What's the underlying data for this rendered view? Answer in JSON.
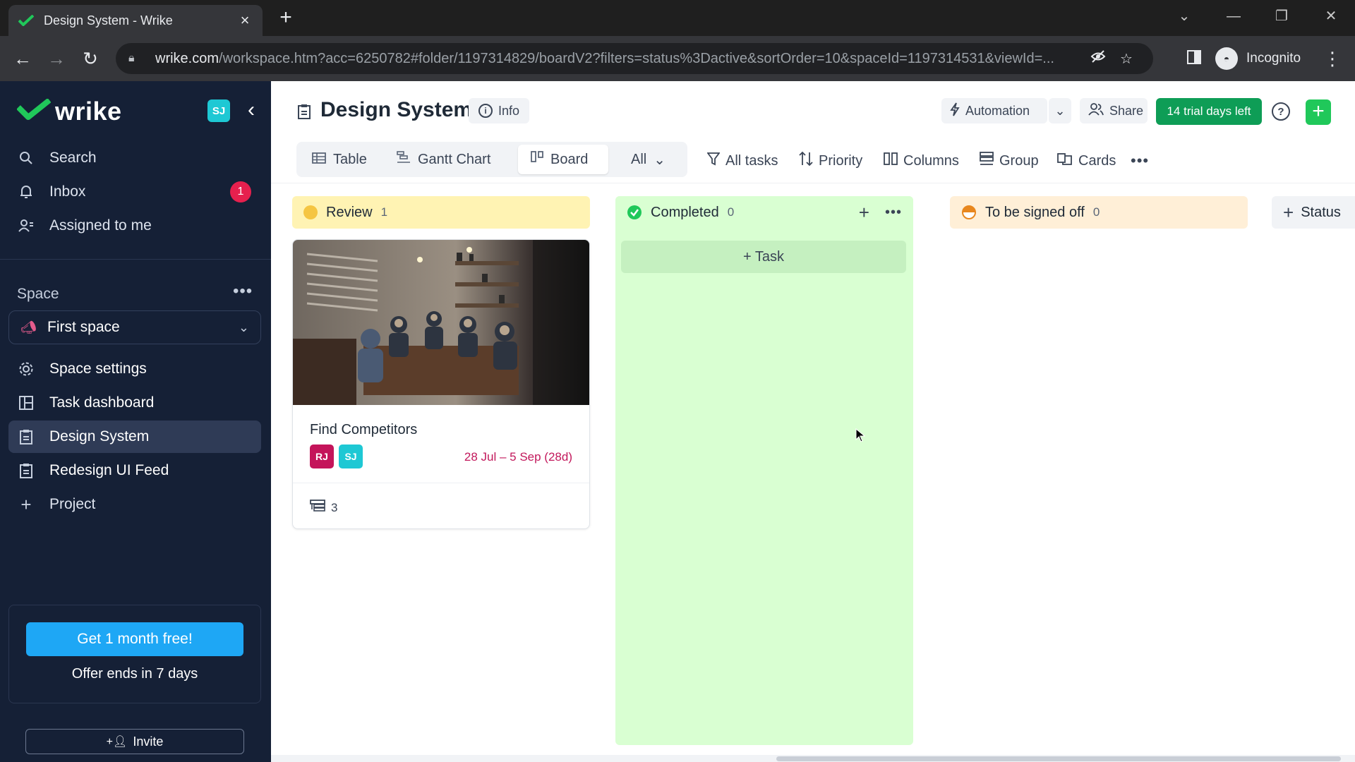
{
  "browser": {
    "tab_title": "Design System - Wrike",
    "url_host": "wrike.com",
    "url_path": "/workspace.htm?acc=6250782#folder/1197314829/boardV2?filters=status%3Dactive&sortOrder=10&spaceId=1197314531&viewId=...",
    "incognito_label": "Incognito"
  },
  "sidebar": {
    "brand": "wrike",
    "user_initials": "SJ",
    "nav": [
      {
        "label": "Search",
        "icon": "search-icon"
      },
      {
        "label": "Inbox",
        "icon": "bell-icon",
        "badge": "1"
      },
      {
        "label": "Assigned to me",
        "icon": "user-icon"
      }
    ],
    "space_label": "Space",
    "space_name": "First space",
    "items": [
      {
        "label": "Space settings",
        "icon": "gear-icon"
      },
      {
        "label": "Task dashboard",
        "icon": "dashboard-icon"
      },
      {
        "label": "Design System",
        "icon": "project-icon",
        "active": true
      },
      {
        "label": "Redesign UI Feed",
        "icon": "project-icon"
      },
      {
        "label": "Project",
        "icon": "plus-icon"
      }
    ],
    "promo": {
      "button": "Get 1 month free!",
      "note": "Offer ends in 7 days"
    },
    "invite_label": "Invite"
  },
  "header": {
    "title": "Design System",
    "info_label": "Info",
    "automation_label": "Automation",
    "share_label": "Share",
    "trial_label": "14 trial days left",
    "colors": {
      "trial": "#0e9d56",
      "add": "#20c85a"
    }
  },
  "views": {
    "tabs": [
      "Table",
      "Gantt Chart",
      "Board"
    ],
    "active": "Board",
    "filter_label": "All"
  },
  "tools": {
    "all_tasks": "All tasks",
    "priority": "Priority",
    "columns": "Columns",
    "group": "Group",
    "cards": "Cards"
  },
  "board": {
    "columns": [
      {
        "name": "Review",
        "count": "1",
        "color": "#fff3b3"
      },
      {
        "name": "Completed",
        "count": "0",
        "color": "#d9ffd2"
      },
      {
        "name": "To be signed off",
        "count": "0",
        "color": "#ffefd7"
      }
    ],
    "add_task_label": "+ Task",
    "add_status_label": "Status",
    "card": {
      "title": "Find Competitors",
      "assignees": [
        "RJ",
        "SJ"
      ],
      "dates": "28 Jul – 5 Sep (28d)",
      "subtasks": "3"
    }
  }
}
